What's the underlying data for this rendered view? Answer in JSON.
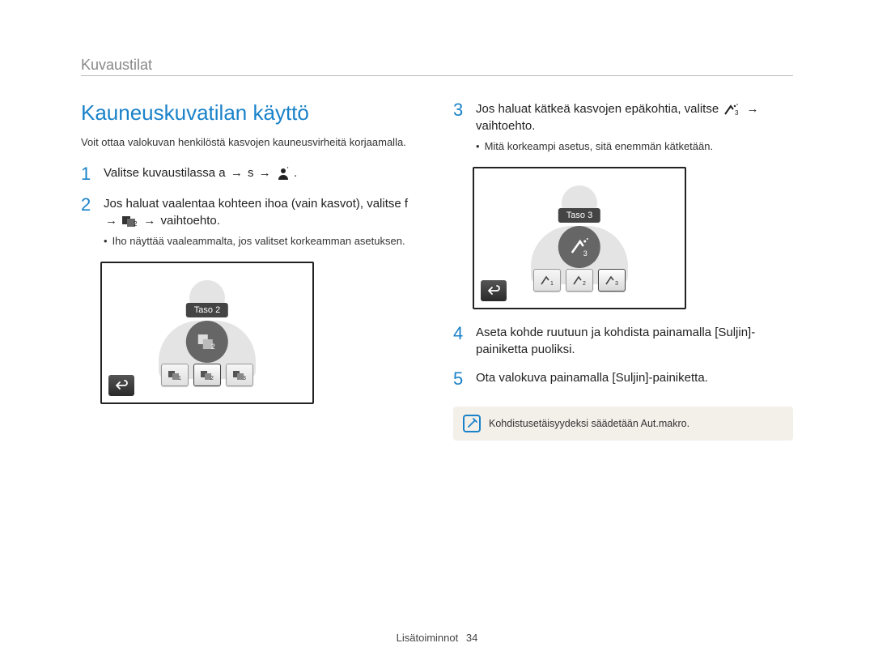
{
  "breadcrumb": "Kuvaustilat",
  "title": "Kauneuskuvatilan käyttö",
  "intro": "Voit ottaa valokuvan henkilöstä kasvojen kauneusvirheitä korjaamalla.",
  "arrow": "→",
  "steps": {
    "s1": {
      "num": "1",
      "a": "Valitse kuvaustilassa a",
      "b": "s",
      "c": "."
    },
    "s2": {
      "num": "2",
      "a": "Jos haluat vaalentaa kohteen ihoa (vain kasvot), valitse f",
      "b": "vaihtoehto.",
      "sub": "Iho näyttää vaaleammalta, jos valitset korkeamman asetuksen."
    },
    "s3": {
      "num": "3",
      "a": "Jos haluat kätkeä kasvojen epäkohtia, valitse",
      "b": "vaihtoehto.",
      "sub": "Mitä korkeampi asetus, sitä enemmän kätketään."
    },
    "s4": {
      "num": "4",
      "text": "Aseta kohde ruutuun ja kohdista painamalla [Suljin]-painiketta puoliksi."
    },
    "s5": {
      "num": "5",
      "text": "Ota valokuva painamalla [Suljin]-painiketta."
    }
  },
  "shots": {
    "left_label": "Taso 2",
    "right_label": "Taso 3"
  },
  "note": "Kohdistusetäisyydeksi säädetään Aut.makro.",
  "footer": {
    "section": "Lisätoiminnot",
    "page": "34"
  },
  "bullet": "•"
}
